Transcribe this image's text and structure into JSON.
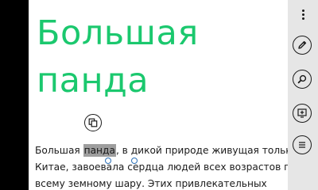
{
  "article": {
    "title_line1": "Большая",
    "title_line2": "панда",
    "body": {
      "line1_before": "Большая ",
      "line1_selected": "панда",
      "line1_after": ", в дикой природе живущая только в",
      "line2": "Китае, завоевала сердца людей всех возрастов по",
      "line3": "всему земному шару. Этих привлекательных"
    }
  },
  "icons": {
    "copy": "copy-icon",
    "more": "more-ellipsis-icon",
    "edit": "pencil-icon",
    "search": "magnifier-icon",
    "add": "add-to-screen-icon",
    "list": "list-icon"
  },
  "colors": {
    "title": "#1bc86e",
    "selection": "#9e9e9e",
    "gripper": "#2a6fb6",
    "app_bar": "#e6e6e6",
    "page": "#ffffff"
  }
}
